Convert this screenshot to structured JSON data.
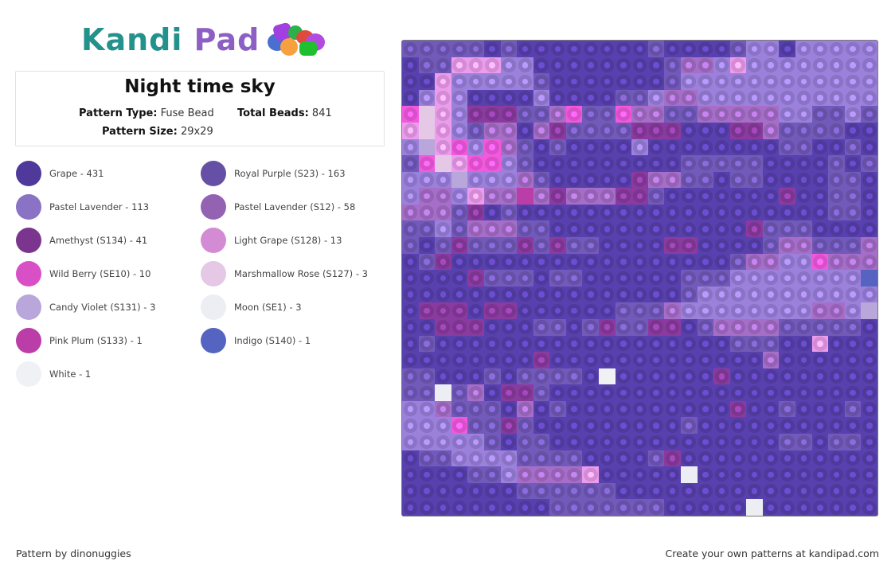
{
  "brand": {
    "name_part1": "Kandi",
    "name_part2": "Pad",
    "logo_icon": "bead-pile-icon"
  },
  "pattern": {
    "title": "Night time sky",
    "type_label": "Pattern Type:",
    "type_value": "Fuse Bead",
    "beads_label": "Total Beads:",
    "beads_value": "841",
    "size_label": "Pattern Size:",
    "size_value": "29x29"
  },
  "legend": [
    {
      "code": "G",
      "label": "Grape - 431",
      "color": "#4f3a9c"
    },
    {
      "code": "R",
      "label": "Royal Purple (S23) - 163",
      "color": "#6650a6"
    },
    {
      "code": "L",
      "label": "Pastel Lavender - 113",
      "color": "#8a72c4"
    },
    {
      "code": "P",
      "label": "Pastel Lavender (S12) - 58",
      "color": "#9462b3"
    },
    {
      "code": "A",
      "label": "Amethyst (S134) - 41",
      "color": "#7c358f"
    },
    {
      "code": "H",
      "label": "Light Grape (S128) - 13",
      "color": "#d38bd3"
    },
    {
      "code": "W",
      "label": "Wild Berry (SE10) - 10",
      "color": "#d94fc6"
    },
    {
      "code": "M",
      "label": "Marshmallow Rose (S127) - 3",
      "color": "#e4c8e6"
    },
    {
      "code": "C",
      "label": "Candy Violet (S131) - 3",
      "color": "#b9a6da"
    },
    {
      "code": "O",
      "label": "Moon (SE1) - 3",
      "color": "#eceef3"
    },
    {
      "code": "K",
      "label": "Pink Plum (S133) - 1",
      "color": "#ba3da8"
    },
    {
      "code": "I",
      "label": "Indigo (S140) - 1",
      "color": "#5563c1"
    },
    {
      "code": "E",
      "label": "White - 1",
      "color": "#f0f1f4"
    }
  ],
  "grid": {
    "columns": 29,
    "rows": [
      "RRRRRGRGGGGGGGGRGGGGRLLGLLLLL",
      "GRRHHHLLGGGGGGGGRPPLHLLLLLLLL",
      "GGHLLLLLRGGGGGGGRLLLLLLLLLLLL",
      "GLHLGGGGLGGGGRRLPPLLLLLLLLLLL",
      "WMHLAAARRPWRRWPPRRPPPPPLLRRLR",
      "HMHLRPPGPARRRRAAAGGGAAPRRRRGG",
      "LCHWLWPRGRGGGGLGGGGGGGGRRGGRG",
      "RWMHWWLRGGGGGGGGGRRRRRGGGGRGR",
      "LLLCLLLPRGGGGGAPPRRGRRGGGGRRG",
      "LPPLHPPKPAPPPAARGGGGGGGAGGRRG",
      "PPPRAGRGGGGGGGGGGGGGGGGGGGRRG",
      "RRLRPPPRRGGGGGGGGGGGGARRRGGGG",
      "RGRARRRARARRGGGGAAGGGGRPPRRRP",
      "GRAGGGGGGGGGGGGGGGGGRPPLLWPPP",
      "GGGGARRRGRRGGGGGGRRRLLLLLLLLI",
      "GGGGGGGGGGGGGGGGGRLLLLLLLLLLL",
      "GAAAGAAGGGGGGRRRPLLLLLLLLPPLC",
      "GGAAAGGGRRGRARRAAGRPPPPRRRRRG",
      "GRGGGGGGGGGGGGGGGGGGRRRGGHGGG",
      "GGGGGGGGAGGGGGGGGGGGGGPGGGGGG",
      "RRGGGRGRRRRGEGGGGGGAGGGGGGGGG",
      "RRORPGAARGGGGGGGGGGGGGGGGGGGG",
      "LLPRRRGPGRGGGGGGGGGGAGGRGGGRG",
      "LLLWRRARGGGGGGGGGRGGGGGGGGGGG",
      "LLLLLRGRRGGGGGGGGGGGGGGRRGRRG",
      "GRRLLLLRRRRGGGGRAGGGGGGGGGGGG",
      "GGGGRRLPPPPHGGGGGOGGGGGGGGGGG",
      "GGGGGGGRRRRRRGGGGGGGGGGGGGGGG",
      "GGGGGGGGGRRRRRRRGGGGGOGGGGGGG"
    ]
  },
  "footer": {
    "credit": "Pattern by dinonuggies",
    "promo": "Create your own patterns at kandipad.com"
  }
}
